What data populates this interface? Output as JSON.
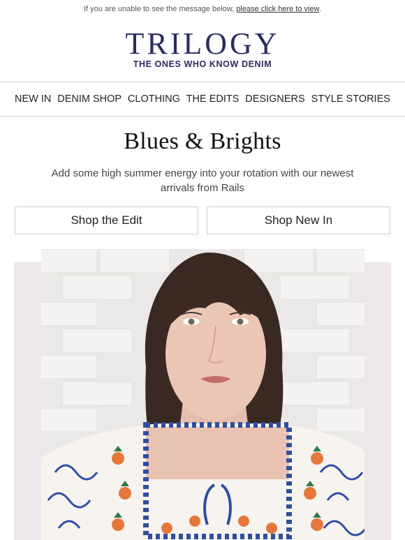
{
  "preheader": {
    "text": "If you are unable to see the message below, ",
    "link": "please click here to view",
    "suffix": "."
  },
  "brand": {
    "logo": "TRILOGY",
    "tagline": "THE ONES WHO KNOW DENIM",
    "color": "#2b2c5e"
  },
  "nav": {
    "items": [
      "NEW IN",
      "DENIM SHOP",
      "CLOTHING",
      "THE EDITS",
      "DESIGNERS",
      "STYLE STORIES"
    ]
  },
  "main": {
    "headline": "Blues & Brights",
    "subcopy": "Add some high summer energy into your rotation with our newest arrivals from Rails",
    "buttons": [
      "Shop the Edit",
      "Shop New In"
    ]
  },
  "hero": {
    "description_icon": "model-photo"
  }
}
